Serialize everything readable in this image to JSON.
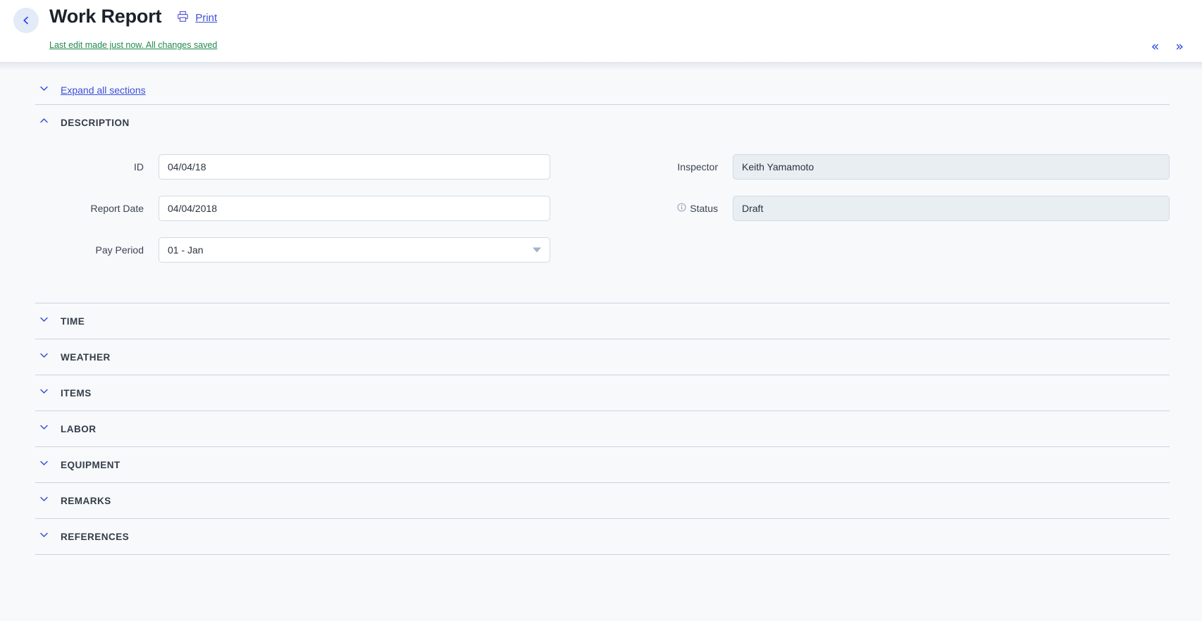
{
  "header": {
    "back_icon": "chevron-left-icon",
    "title": "Work Report",
    "print_icon": "printer-icon",
    "print_label": "Print",
    "save_status": "Last edit made just now. All changes saved",
    "prev_label": "«",
    "next_label": "»",
    "accent_blue": "#3b4fd8",
    "success_green": "#1f8a4c"
  },
  "toolbar": {
    "expand_all_label": "Expand all sections",
    "expand_icon": "chevron-down-icon"
  },
  "description_section": {
    "title": "DESCRIPTION",
    "collapse_icon": "chevron-up-icon",
    "left_fields": [
      {
        "label": "ID",
        "value": "04/04/18",
        "type": "text",
        "readonly": false
      },
      {
        "label": "Report Date",
        "value": "04/04/2018",
        "type": "text",
        "readonly": false
      },
      {
        "label": "Pay Period",
        "value": "01 - Jan",
        "type": "select",
        "readonly": false,
        "caret_icon": "caret-down-icon"
      }
    ],
    "right_fields": [
      {
        "label": "Inspector",
        "value": "Keith Yamamoto",
        "type": "text",
        "readonly": true,
        "icon": ""
      },
      {
        "label": "Status",
        "value": "Draft",
        "type": "text",
        "readonly": true,
        "icon": "info-icon"
      }
    ]
  },
  "collapsed_sections": [
    {
      "title": "TIME",
      "icon": "chevron-down-icon"
    },
    {
      "title": "WEATHER",
      "icon": "chevron-down-icon"
    },
    {
      "title": "ITEMS",
      "icon": "chevron-down-icon"
    },
    {
      "title": "LABOR",
      "icon": "chevron-down-icon"
    },
    {
      "title": "EQUIPMENT",
      "icon": "chevron-down-icon"
    },
    {
      "title": "REMARKS",
      "icon": "chevron-down-icon"
    },
    {
      "title": "REFERENCES",
      "icon": "chevron-down-icon"
    }
  ]
}
